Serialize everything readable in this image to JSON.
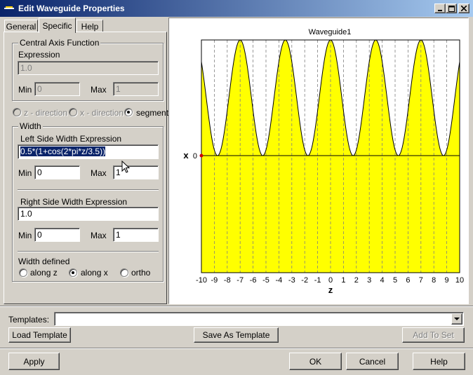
{
  "window": {
    "title": "Edit Waveguide Properties"
  },
  "tabs": [
    "General",
    "Specific",
    "Help"
  ],
  "central_axis": {
    "group_label": "Central Axis Function",
    "expression_label": "Expression",
    "expression_value": "1.0",
    "min_label": "Min",
    "min_value": "0",
    "max_label": "Max",
    "max_value": "1"
  },
  "direction": {
    "options": [
      "z - direction",
      "x - direction",
      "segment"
    ],
    "selected": "segment"
  },
  "width": {
    "group_label": "Width",
    "left_label": "Left Side Width Expression",
    "left_value": "0.5*(1+cos(2*pi*z/3.5))",
    "left_min_label": "Min",
    "left_min_value": "0",
    "left_max_label": "Max",
    "left_max_value": "1",
    "right_label": "Right Side Width Expression",
    "right_value": "1.0",
    "right_min_label": "Min",
    "right_min_value": "0",
    "right_max_label": "Max",
    "right_max_value": "1",
    "defined_label": "Width defined",
    "defined_options": [
      "along z",
      "along x",
      "ortho"
    ],
    "defined_selected": "along x"
  },
  "templates": {
    "label": "Templates:",
    "value": "",
    "load_button": "Load Template",
    "save_button": "Save As Template",
    "add_button": "Add To Set"
  },
  "footer": {
    "apply": "Apply",
    "ok": "OK",
    "cancel": "Cancel",
    "help": "Help"
  },
  "colors": {
    "fill": "#ffff00",
    "title_start": "#0a246a",
    "title_end": "#a6caf0"
  },
  "chart_data": {
    "type": "area",
    "title": "Waveguide1",
    "xlabel": "z",
    "ylabel": "x",
    "xlim": [
      -10,
      10
    ],
    "x_ticks": [
      "-10",
      "-9",
      "-8",
      "-7",
      "-6",
      "-5",
      "-4",
      "-3",
      "-2",
      "-1",
      "0",
      "1",
      "2",
      "3",
      "4",
      "5",
      "6",
      "7",
      "8",
      "9",
      "10"
    ],
    "y_ticks": [
      "0"
    ],
    "function": "0.5*(1+cos(2*pi*z/3.5))",
    "grid": "vertical dashed at integer z",
    "left_width_upper_max": 1,
    "right_width_lower": 1
  }
}
